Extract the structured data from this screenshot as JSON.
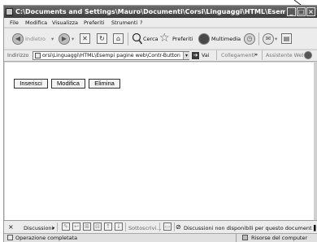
{
  "window": {
    "title": "C:\\Documents and Settings\\Mauro\\Documenti\\Corsi\\Linguaggi\\HTML\\Esempi pagine web\\...",
    "minimize": "_",
    "maximize": "□",
    "close": "×"
  },
  "menubar": {
    "items": [
      "File",
      "Modifica",
      "Visualizza",
      "Preferiti",
      "Strumenti",
      "?"
    ]
  },
  "toolbar": {
    "back_label": "Indietro",
    "search_label": "Cerca",
    "favorites_label": "Preferiti",
    "multimedia_label": "Multimedia"
  },
  "addressbar": {
    "label": "Indirizzo",
    "value": "orsi\\Linguaggi\\HTML\\Esempi pagine web\\Contr-Button.htm",
    "go_label": "Vai",
    "links_label": "Collegamenti",
    "assistant_label": "Assistente Web"
  },
  "content": {
    "buttons": [
      "Inserisci",
      "Modifica",
      "Elimina"
    ]
  },
  "discussion_bar": {
    "close": "×",
    "discussions_label": "Discussioni",
    "subscribe_label": "Sottoscrivi...",
    "message": "Discussioni non disponibili per questo documento"
  },
  "statusbar": {
    "left": "Operazione completata",
    "right": "Risorse del computer"
  }
}
